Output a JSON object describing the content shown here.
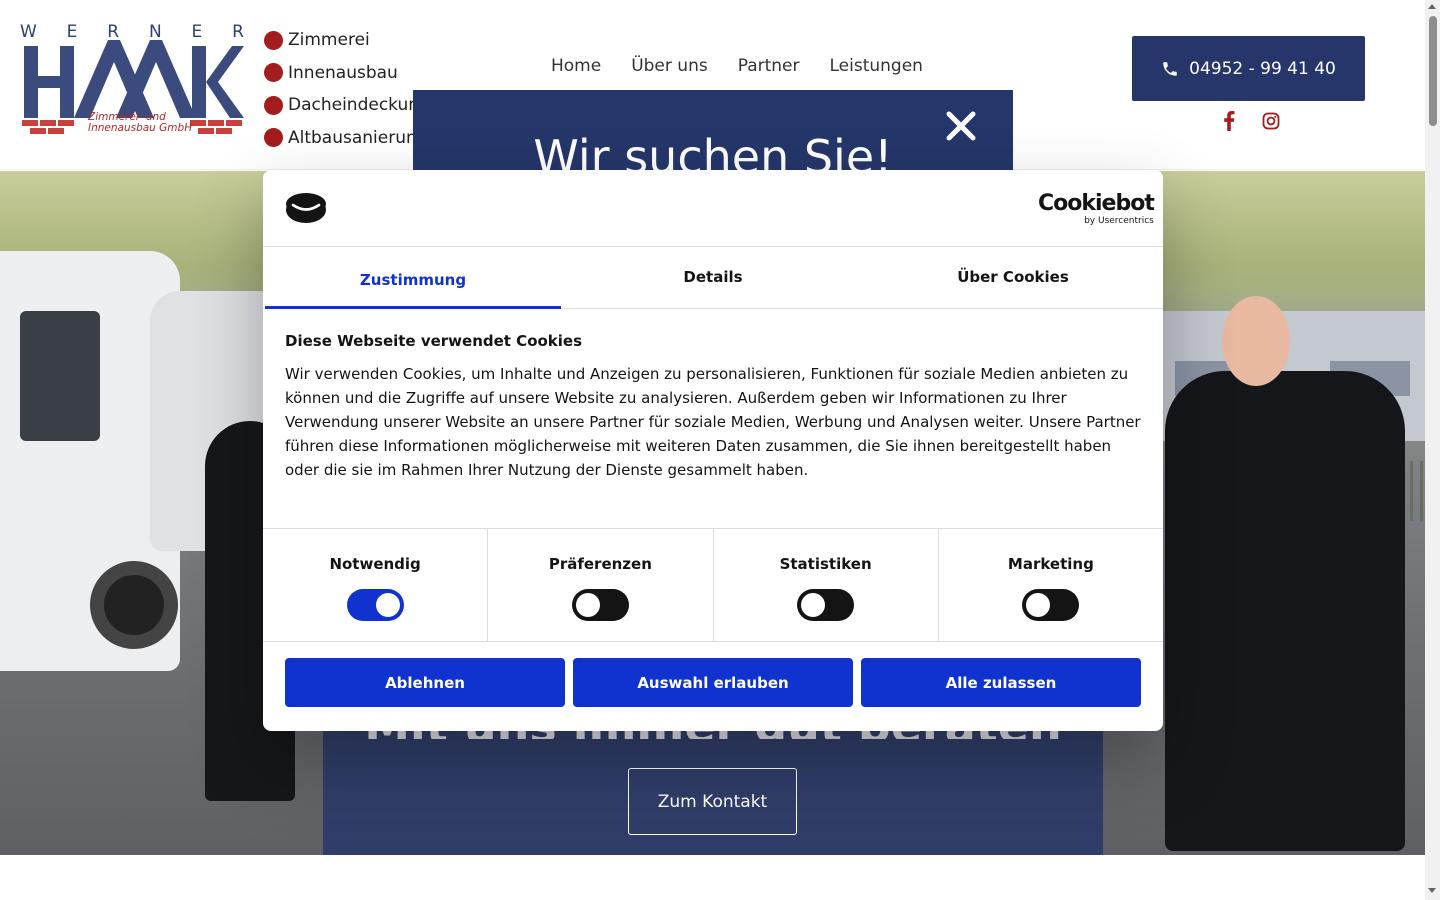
{
  "logo": {
    "letters": [
      "W",
      "E",
      "R",
      "N",
      "E",
      "R"
    ],
    "wordmark": "HAAK",
    "subline1": "Zimmerei- und",
    "subline2": "Innenausbau GmbH"
  },
  "quick_links": [
    "Zimmerei",
    "Innenausbau",
    "Dacheindeckung",
    "Altbausanierung"
  ],
  "nav": {
    "items": [
      "Home",
      "Über uns",
      "Partner",
      "Leistungen"
    ]
  },
  "contact": {
    "phone": "04952 - 99 41 40",
    "phone_icon": "phone-icon"
  },
  "socials": [
    "facebook-icon",
    "instagram-icon"
  ],
  "announcement": {
    "title": "Wir suchen Sie!",
    "close_icon": "close-icon"
  },
  "hero": {
    "tagline": "Mit uns immer gut beraten",
    "cta": "Zum Kontakt"
  },
  "cookie": {
    "brand": "Cookiebot",
    "brand_sub": "by Usercentrics",
    "tabs": [
      "Zustimmung",
      "Details",
      "Über Cookies"
    ],
    "active_tab": "Zustimmung",
    "title": "Diese Webseite verwendet Cookies",
    "text": "Wir verwenden Cookies, um Inhalte und Anzeigen zu personalisieren, Funktionen für soziale Medien anbieten zu können und die Zugriffe auf unsere Website zu analysieren. Außerdem geben wir Informationen zu Ihrer Verwendung unserer Website an unsere Partner für soziale Medien, Werbung und Analysen weiter. Unsere Partner führen diese Informationen möglicherweise mit weiteren Daten zusammen, die Sie ihnen bereitgestellt haben oder die sie im Rahmen Ihrer Nutzung der Dienste gesammelt haben.",
    "categories": [
      {
        "label": "Notwendig",
        "enabled": true
      },
      {
        "label": "Präferenzen",
        "enabled": false
      },
      {
        "label": "Statistiken",
        "enabled": false
      },
      {
        "label": "Marketing",
        "enabled": false
      }
    ],
    "buttons": {
      "deny": "Ablehnen",
      "allow_selection": "Auswahl erlauben",
      "allow_all": "Alle zulassen"
    }
  },
  "colors": {
    "brand_navy": "#26356a",
    "brand_red": "#a31d1d",
    "cookie_blue": "#1032cf"
  }
}
